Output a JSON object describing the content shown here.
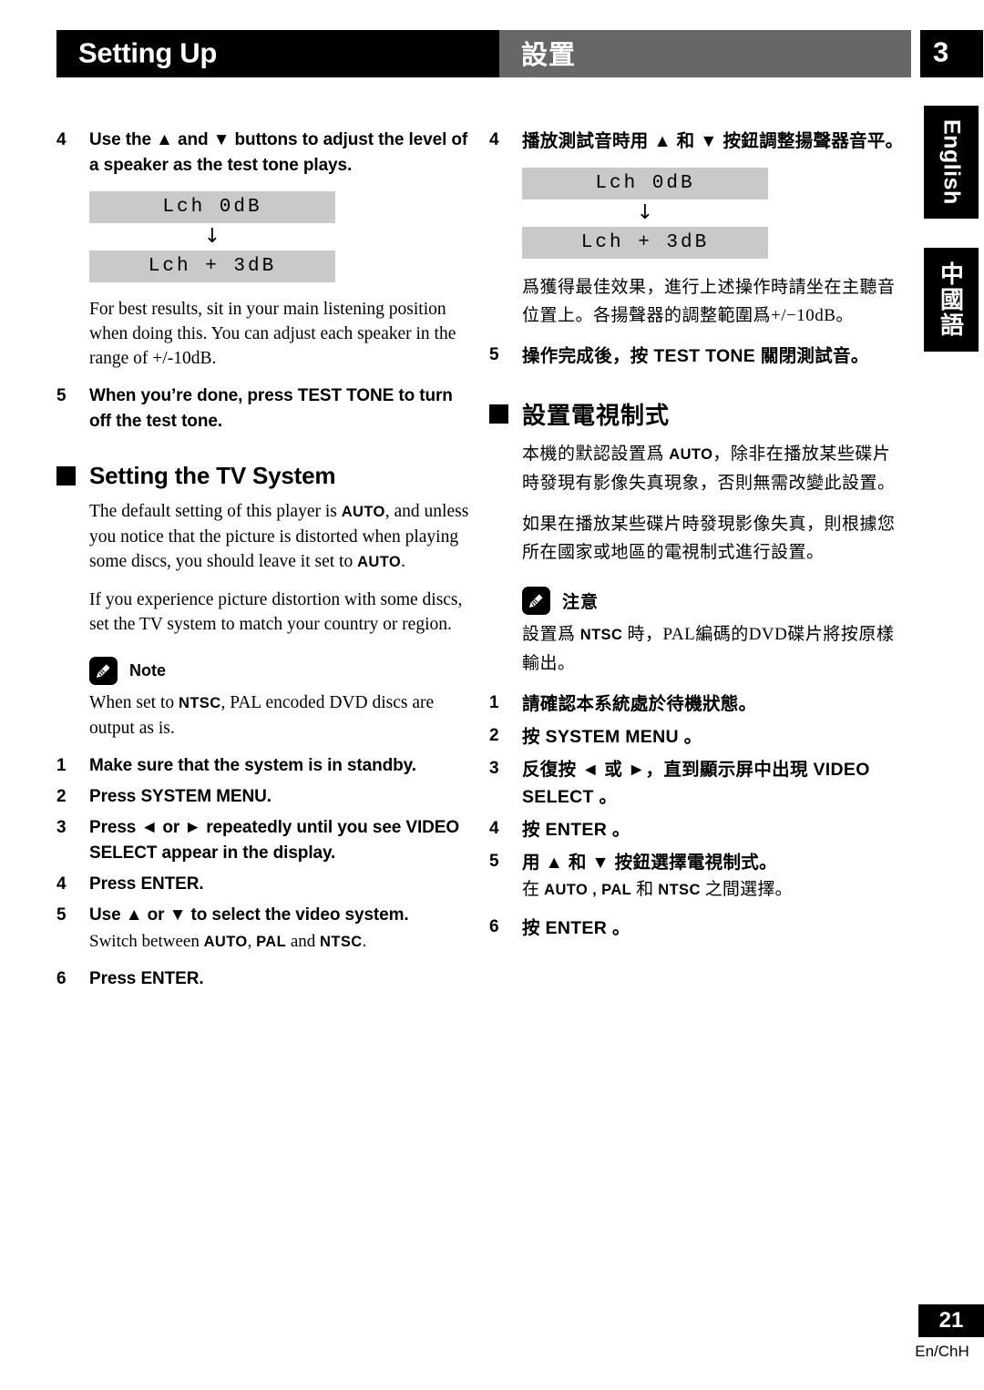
{
  "header": {
    "title_en": "Setting Up",
    "title_cn": "設置",
    "chapter_number": "3"
  },
  "side_tabs": [
    {
      "label": "English"
    },
    {
      "label": "中國語"
    }
  ],
  "footer": {
    "page_number": "21",
    "edition": "En/ChH"
  },
  "left_column": {
    "step4": {
      "num": "4",
      "text": "Use the ▲ and ▼ buttons to adjust the level of a speaker as the test tone plays."
    },
    "display": {
      "before": "Lch   0dB",
      "arrow": "↓",
      "after": "Lch + 3dB"
    },
    "para_best_results": "For best results, sit in your main listening position when doing this. You can adjust each speaker in the range of +/-10dB.",
    "step5": {
      "num": "5",
      "text": "When you’re done, press TEST TONE to turn off the test tone."
    },
    "section": {
      "title": "Setting the TV System",
      "para1_a": "The default setting of this player is ",
      "para1_b": "AUTO",
      "para1_c": ", and unless you notice that the picture is distorted when playing some discs, you should leave it set to ",
      "para1_d": "AUTO",
      "para1_e": ".",
      "para2": "If you experience picture distortion with some discs, set the TV system to match your country or region."
    },
    "note": {
      "label": "Note",
      "text_a": "When set to ",
      "text_b": "NTSC",
      "text_c": ", PAL encoded DVD discs are output as is."
    },
    "steps": [
      {
        "num": "1",
        "text": "Make sure that the system is in standby."
      },
      {
        "num": "2",
        "text": "Press SYSTEM MENU."
      },
      {
        "num": "3",
        "text": "Press ◄ or ► repeatedly until you see VIDEO SELECT appear in the display."
      },
      {
        "num": "4",
        "text": "Press ENTER."
      },
      {
        "num": "5",
        "text": "Use ▲ or ▼ to select the video system.",
        "sub_a": "Switch between ",
        "sub_b": "AUTO",
        "sub_c": ", ",
        "sub_d": "PAL",
        "sub_e": " and ",
        "sub_f": "NTSC",
        "sub_g": "."
      },
      {
        "num": "6",
        "text": "Press ENTER."
      }
    ]
  },
  "right_column": {
    "step4": {
      "num": "4",
      "text": "播放測試音時用 ▲ 和 ▼ 按鈕調整揚聲器音平。"
    },
    "display": {
      "before": "Lch   0dB",
      "arrow": "↓",
      "after": "Lch + 3dB"
    },
    "para_best_results": "爲獲得最佳效果，進行上述操作時請坐在主聽音位置上。各揚聲器的調整範圍爲+/−10dB。",
    "step5": {
      "num": "5",
      "text_a": "操作完成後，按 ",
      "text_b": "TEST TONE",
      "text_c": " 關閉測試音。"
    },
    "section": {
      "title": "設置電視制式",
      "para1_a": "本機的默認設置爲 ",
      "para1_b": "AUTO",
      "para1_c": "，除非在播放某些碟片時發現有影像失真現象，否則無需改變此設置。",
      "para2": "如果在播放某些碟片時發現影像失真，則根據您所在國家或地區的電視制式進行設置。"
    },
    "note": {
      "label": "注意",
      "text_a": "設置爲 ",
      "text_b": "NTSC",
      "text_c": " 時，PAL編碼的DVD碟片將按原樣輸出。"
    },
    "steps": [
      {
        "num": "1",
        "text": "請確認本系統處於待機狀態。"
      },
      {
        "num": "2",
        "text_a": "按 ",
        "text_b": "SYSTEM MENU",
        "text_c": " 。"
      },
      {
        "num": "3",
        "text_a": "反復按 ◄ 或 ►，直到顯示屏中出現 ",
        "text_b": "VIDEO SELECT",
        "text_c": " 。"
      },
      {
        "num": "4",
        "text_a": "按 ",
        "text_b": "ENTER",
        "text_c": " 。"
      },
      {
        "num": "5",
        "text": "用 ▲ 和 ▼ 按鈕選擇電視制式。",
        "sub_a": "在 ",
        "sub_b": "AUTO , PAL",
        "sub_c": " 和 ",
        "sub_d": "NTSC",
        "sub_e": " 之間選擇。"
      },
      {
        "num": "6",
        "text_a": "按 ",
        "text_b": "ENTER",
        "text_c": " 。"
      }
    ]
  }
}
